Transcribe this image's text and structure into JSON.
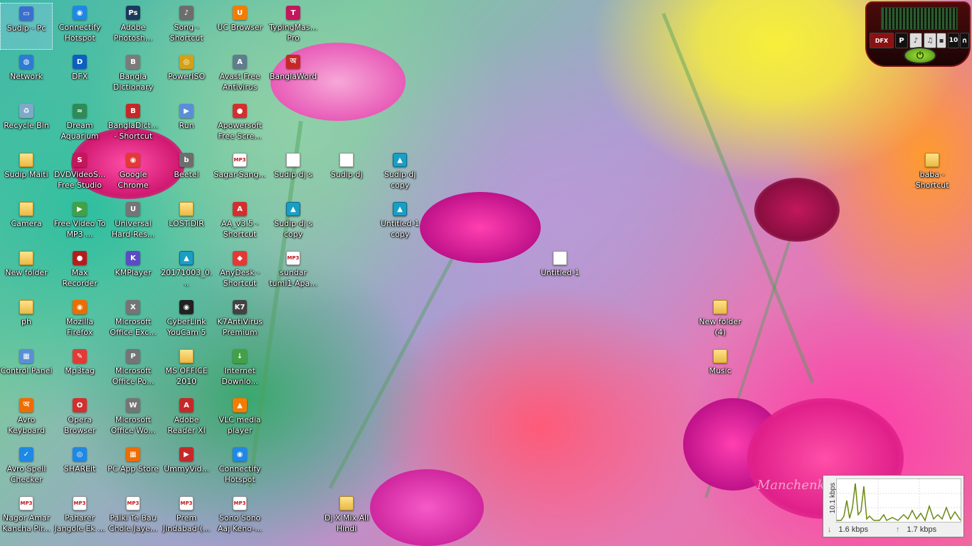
{
  "desktop": {
    "watermark": "Manchenk",
    "icons": [
      {
        "label": "Sudip - Pc",
        "kind": "computer",
        "glyph": "▭",
        "color": "#3a6fd0",
        "selected": true
      },
      {
        "label": "Connectify Hotspot 2017",
        "kind": "app",
        "glyph": "◉",
        "color": "#1e88e5"
      },
      {
        "label": "Adobe Photosh...",
        "kind": "app",
        "glyph": "Ps",
        "color": "#1b3a5c"
      },
      {
        "label": "Song - Shortcut",
        "kind": "app",
        "glyph": "♪",
        "color": "#6d6d6d"
      },
      {
        "label": "UC Browser",
        "kind": "app",
        "glyph": "U",
        "color": "#f57c00"
      },
      {
        "label": "TypingMas... Pro",
        "kind": "app",
        "glyph": "T",
        "color": "#c2185b"
      },
      {
        "label": "Network",
        "kind": "app",
        "glyph": "◍",
        "color": "#2e7bd6"
      },
      {
        "label": "DFX",
        "kind": "app",
        "glyph": "D",
        "color": "#0d5fbf"
      },
      {
        "label": "Bangla Dictionary",
        "kind": "app",
        "glyph": "B",
        "color": "#7b7b7b"
      },
      {
        "label": "PowerISO",
        "kind": "app",
        "glyph": "◎",
        "color": "#d4a017"
      },
      {
        "label": "Avast Free Antivirus",
        "kind": "app",
        "glyph": "A",
        "color": "#607d8b"
      },
      {
        "label": "BanglaWord",
        "kind": "app",
        "glyph": "অ",
        "color": "#c62828"
      },
      {
        "label": "Recycle Bin",
        "kind": "app",
        "glyph": "♻",
        "color": "#7ea9c9"
      },
      {
        "label": "Dream Aquarium",
        "kind": "app",
        "glyph": "≈",
        "color": "#2e8b57"
      },
      {
        "label": "BanglaDict... - Shortcut",
        "kind": "app",
        "glyph": "B",
        "color": "#c62828"
      },
      {
        "label": "Run",
        "kind": "app",
        "glyph": "▶",
        "color": "#5a8fd6"
      },
      {
        "label": "Apowersoft Free Scre...",
        "kind": "app",
        "glyph": "●",
        "color": "#d32f2f"
      },
      {
        "label": "Sudip dj s",
        "kind": "doc",
        "glyph": "",
        "color": "#ffffff"
      },
      {
        "label": "Sudip dj",
        "kind": "doc",
        "glyph": "",
        "color": "#ffffff"
      },
      {
        "label": "Sudip dj copy",
        "kind": "img",
        "glyph": "▲",
        "color": "#1a9ec4"
      },
      {
        "label": "baba - Shortcut",
        "kind": "folder",
        "glyph": "",
        "color": "#e9b946"
      },
      {
        "label": "Sudip Maiti",
        "kind": "folder",
        "glyph": "",
        "color": "#e9b946"
      },
      {
        "label": "DVDVideoS... Free Studio",
        "kind": "app",
        "glyph": "S",
        "color": "#c2185b"
      },
      {
        "label": "Google Chrome",
        "kind": "app",
        "glyph": "◉",
        "color": "#e53935"
      },
      {
        "label": "Beetel",
        "kind": "app",
        "glyph": "b",
        "color": "#6d6d6d"
      },
      {
        "label": "Sagar-Sang...",
        "kind": "mp3",
        "glyph": "MP3",
        "color": "#ffffff"
      },
      {
        "label": "Camera",
        "kind": "folder",
        "glyph": "",
        "color": "#e9b946"
      },
      {
        "label": "Free Video To MP3 ...",
        "kind": "app",
        "glyph": "▶",
        "color": "#43a047"
      },
      {
        "label": "Universal Hard-Res...",
        "kind": "app",
        "glyph": "U",
        "color": "#757575"
      },
      {
        "label": "LOST.DIR",
        "kind": "folder",
        "glyph": "",
        "color": "#e9b946"
      },
      {
        "label": "AA_v3.5 - Shortcut",
        "kind": "app",
        "glyph": "A",
        "color": "#d32f2f"
      },
      {
        "label": "Sudip dj s copy",
        "kind": "img",
        "glyph": "▲",
        "color": "#1a9ec4"
      },
      {
        "label": "Untitled-1 copy",
        "kind": "img",
        "glyph": "▲",
        "color": "#1a9ec4"
      },
      {
        "label": "Untitled-1",
        "kind": "doc",
        "glyph": "",
        "color": "#ffffff"
      },
      {
        "label": "New folder",
        "kind": "folder",
        "glyph": "",
        "color": "#e9b946"
      },
      {
        "label": "Max Recorder",
        "kind": "app",
        "glyph": "●",
        "color": "#b71c1c"
      },
      {
        "label": "KMPlayer",
        "kind": "app",
        "glyph": "K",
        "color": "#5c4bc4"
      },
      {
        "label": "20171003_0...",
        "kind": "img",
        "glyph": "▲",
        "color": "#1a9ec4"
      },
      {
        "label": "AnyDesk - Shortcut",
        "kind": "app",
        "glyph": "◆",
        "color": "#e53935"
      },
      {
        "label": "sundar tumi1-Apa...",
        "kind": "mp3",
        "glyph": "MP3",
        "color": "#ffffff"
      },
      {
        "label": "ph",
        "kind": "folder",
        "glyph": "",
        "color": "#e9b946"
      },
      {
        "label": "Mozilla Firefox",
        "kind": "app",
        "glyph": "◉",
        "color": "#ef6c00"
      },
      {
        "label": "Microsoft Office Exc...",
        "kind": "app",
        "glyph": "X",
        "color": "#757575"
      },
      {
        "label": "CyberLink YouCam 5",
        "kind": "app",
        "glyph": "◉",
        "color": "#212121"
      },
      {
        "label": "K7AntiVirus Premium",
        "kind": "app",
        "glyph": "K7",
        "color": "#424242"
      },
      {
        "label": "New folder (4)",
        "kind": "folder",
        "glyph": "",
        "color": "#e9b946"
      },
      {
        "label": "Control Panel",
        "kind": "app",
        "glyph": "▦",
        "color": "#5a8fd6"
      },
      {
        "label": "Mp3tag",
        "kind": "app",
        "glyph": "✎",
        "color": "#e53935"
      },
      {
        "label": "Microsoft Office Po...",
        "kind": "app",
        "glyph": "P",
        "color": "#757575"
      },
      {
        "label": "MS OFFICE 2010",
        "kind": "folder",
        "glyph": "",
        "color": "#e9b946"
      },
      {
        "label": "Internet Downlo...",
        "kind": "app",
        "glyph": "↓",
        "color": "#43a047"
      },
      {
        "label": "Music",
        "kind": "folder",
        "glyph": "",
        "color": "#e9b946"
      },
      {
        "label": "Avro Keyboard",
        "kind": "app",
        "glyph": "অ",
        "color": "#ef6c00"
      },
      {
        "label": "Opera Browser",
        "kind": "app",
        "glyph": "O",
        "color": "#d32f2f"
      },
      {
        "label": "Microsoft Office Wo...",
        "kind": "app",
        "glyph": "W",
        "color": "#757575"
      },
      {
        "label": "Adobe Reader XI",
        "kind": "app",
        "glyph": "A",
        "color": "#c62828"
      },
      {
        "label": "VLC media player",
        "kind": "app",
        "glyph": "▲",
        "color": "#f57c00"
      },
      {
        "label": "Avro Spell Checker",
        "kind": "app",
        "glyph": "✓",
        "color": "#1e88e5"
      },
      {
        "label": "SHAREit",
        "kind": "app",
        "glyph": "◎",
        "color": "#1e88e5"
      },
      {
        "label": "PC App Store",
        "kind": "app",
        "glyph": "▦",
        "color": "#ef6c00"
      },
      {
        "label": "UmmyVid...",
        "kind": "app",
        "glyph": "▶",
        "color": "#c62828"
      },
      {
        "label": "Connectify Hotspot 2018",
        "kind": "app",
        "glyph": "◉",
        "color": "#1e88e5"
      },
      {
        "label": "Nagor Amar Kancha Pir...",
        "kind": "mp3",
        "glyph": "MP3",
        "color": "#ffffff"
      },
      {
        "label": "Paharer Jangole Ek ...",
        "kind": "mp3",
        "glyph": "MP3",
        "color": "#ffffff"
      },
      {
        "label": "Palki Te Bau Chole Jaye...",
        "kind": "mp3",
        "glyph": "MP3",
        "color": "#ffffff"
      },
      {
        "label": "Prem Jindabad-(...",
        "kind": "mp3",
        "glyph": "MP3",
        "color": "#ffffff"
      },
      {
        "label": "Sono Sono Aaj Keno-...",
        "kind": "mp3",
        "glyph": "MP3",
        "color": "#ffffff"
      },
      {
        "label": "Dj X Mix All Hindi",
        "kind": "folder",
        "glyph": "",
        "color": "#e9b946"
      }
    ]
  },
  "dfx": {
    "logo": "DFX",
    "button_p": "P",
    "button_music": "♪",
    "button_10": "10",
    "power_symbol": "⏻"
  },
  "net_meter": {
    "axis_label": "10.1 kbps",
    "download_rate": "1.6 kbps",
    "upload_rate": "1.7 kbps",
    "download_color": "#e53935",
    "upload_color": "#43a047",
    "graph_color": "#6a8a10"
  }
}
